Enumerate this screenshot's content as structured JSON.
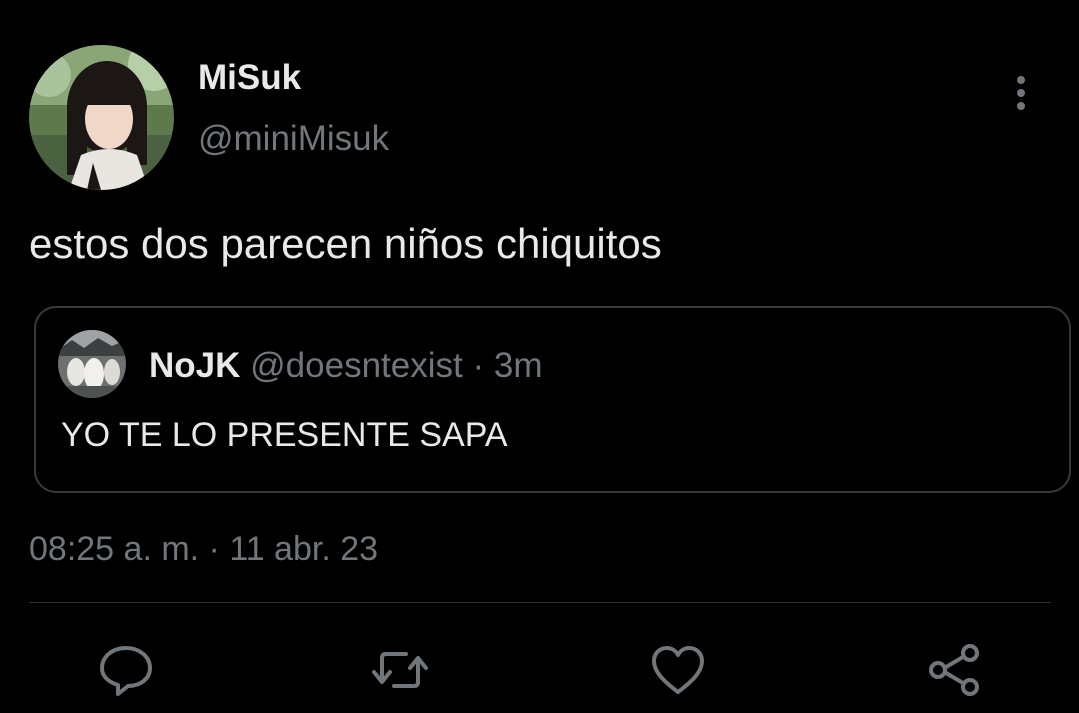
{
  "author": {
    "name": "MiSuk",
    "handle": "@miniMisuk",
    "avatar": "profile-photo"
  },
  "more_icon": "more-vertical-icon",
  "tweet": {
    "text": "estos dos parecen niños chiquitos",
    "timestamp": "08:25 a. m. · 11 abr. 23"
  },
  "quoted_tweet": {
    "name": "NoJK",
    "handle": "@doesntexist",
    "separator": "·",
    "time": "3m",
    "text": "YO TE LO PRESENTE SAPA",
    "avatar": "profile-photo"
  },
  "actions": [
    {
      "name": "reply",
      "icon": "reply-icon"
    },
    {
      "name": "retweet",
      "icon": "retweet-icon"
    },
    {
      "name": "like",
      "icon": "heart-icon"
    },
    {
      "name": "share",
      "icon": "share-icon"
    }
  ],
  "colors": {
    "background": "#000000",
    "primary_text": "#e7e9ea",
    "secondary_text": "#71767b",
    "border": "#38393c",
    "divider": "#2f3336"
  }
}
